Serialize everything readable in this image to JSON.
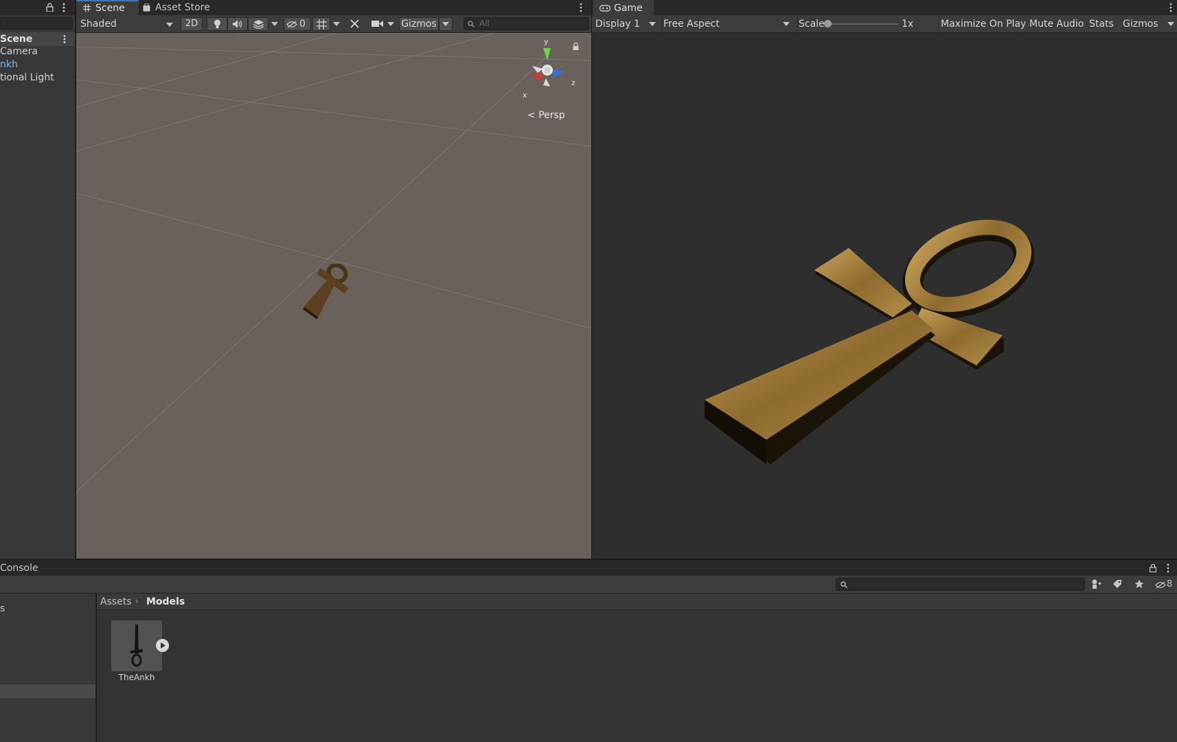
{
  "hierarchy": {
    "scene_label": "Scene",
    "items": [
      "Camera",
      "nkh",
      "tional Light"
    ]
  },
  "scene_tabs": {
    "scene": "Scene",
    "asset_store": "Asset Store"
  },
  "scene_toolbar": {
    "shading_mode": "Shaded",
    "mode_2d": "2D",
    "hidden_count": "0",
    "gizmos": "Gizmos",
    "search_placeholder": "All"
  },
  "scene_view": {
    "gizmo_y": "y",
    "gizmo_x": "x",
    "gizmo_z": "z",
    "projection": "Persp"
  },
  "game_tab": {
    "label": "Game"
  },
  "game_toolbar": {
    "display": "Display 1",
    "aspect": "Free Aspect",
    "scale_label": "Scale",
    "scale_value": "1x",
    "scale_level": 0,
    "maximize_on_play": "Maximize On Play",
    "mute_audio": "Mute Audio",
    "stats": "Stats",
    "gizmos": "Gizmos"
  },
  "bottom": {
    "console_tab": "Console",
    "hidden_count": "8",
    "left_item": "s",
    "breadcrumb": [
      "Assets",
      "Models"
    ],
    "assets": [
      {
        "name": "TheAnkh"
      }
    ]
  },
  "colors": {
    "accent": "#3a79bb",
    "selection_blue": "#7fb4f0",
    "scene_bg": "#6b615c",
    "game_bg": "#2e2e2e",
    "ankh_gold": "#b08a45"
  }
}
